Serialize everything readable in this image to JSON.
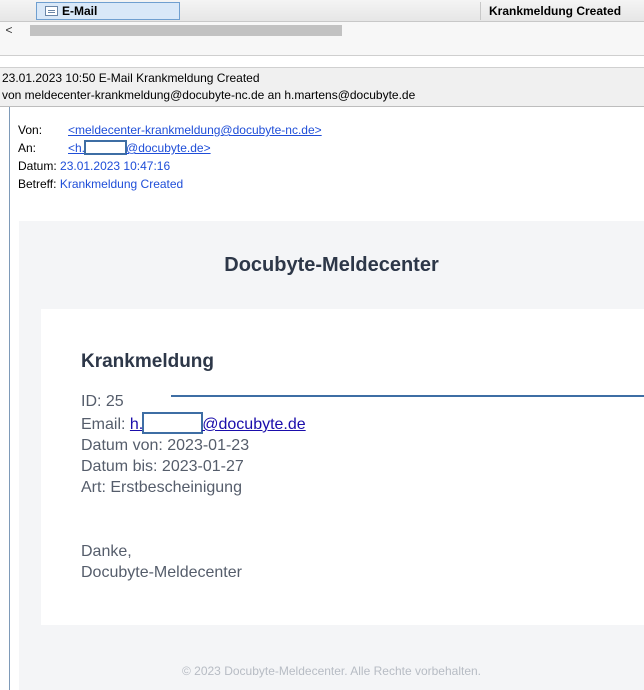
{
  "tabbar": {
    "tab_label": "E-Mail",
    "subject_column": "Krankmeldung Created"
  },
  "scroll": {
    "left_arrow": "<"
  },
  "infobar": {
    "line1": "23.01.2023 10:50 E-Mail Krankmeldung Created",
    "line2": "von meldecenter-krankmeldung@docubyte-nc.de an h.martens@docubyte.de"
  },
  "headers": {
    "from_label": "Von:",
    "from_value": "<meldecenter-krankmeldung@docubyte-nc.de>",
    "to_label": "An:",
    "to_prefix": "<h.",
    "to_suffix": "@docubyte.de>",
    "date_label": "Datum:",
    "date_value": "23.01.2023 10:47:16",
    "subject_label": "Betreff:",
    "subject_value": "Krankmeldung Created"
  },
  "body": {
    "brand": "Docubyte-Meldecenter",
    "card_title": "Krankmeldung",
    "id_line": "ID: 25",
    "email_label": "Email: ",
    "email_prefix": "h.",
    "email_suffix": "@docubyte.de",
    "date_from": "Datum von: 2023-01-23",
    "date_to": "Datum bis: 2023-01-27",
    "type": "Art: Erstbescheinigung",
    "thanks": "Danke,",
    "signature": "Docubyte-Meldecenter",
    "footer": "© 2023 Docubyte-Meldecenter. Alle Rechte vorbehalten."
  },
  "colors": {
    "link": "#1f4ed8",
    "redaction": "#3e6ea4",
    "tab_active": "#d9e8f8"
  }
}
